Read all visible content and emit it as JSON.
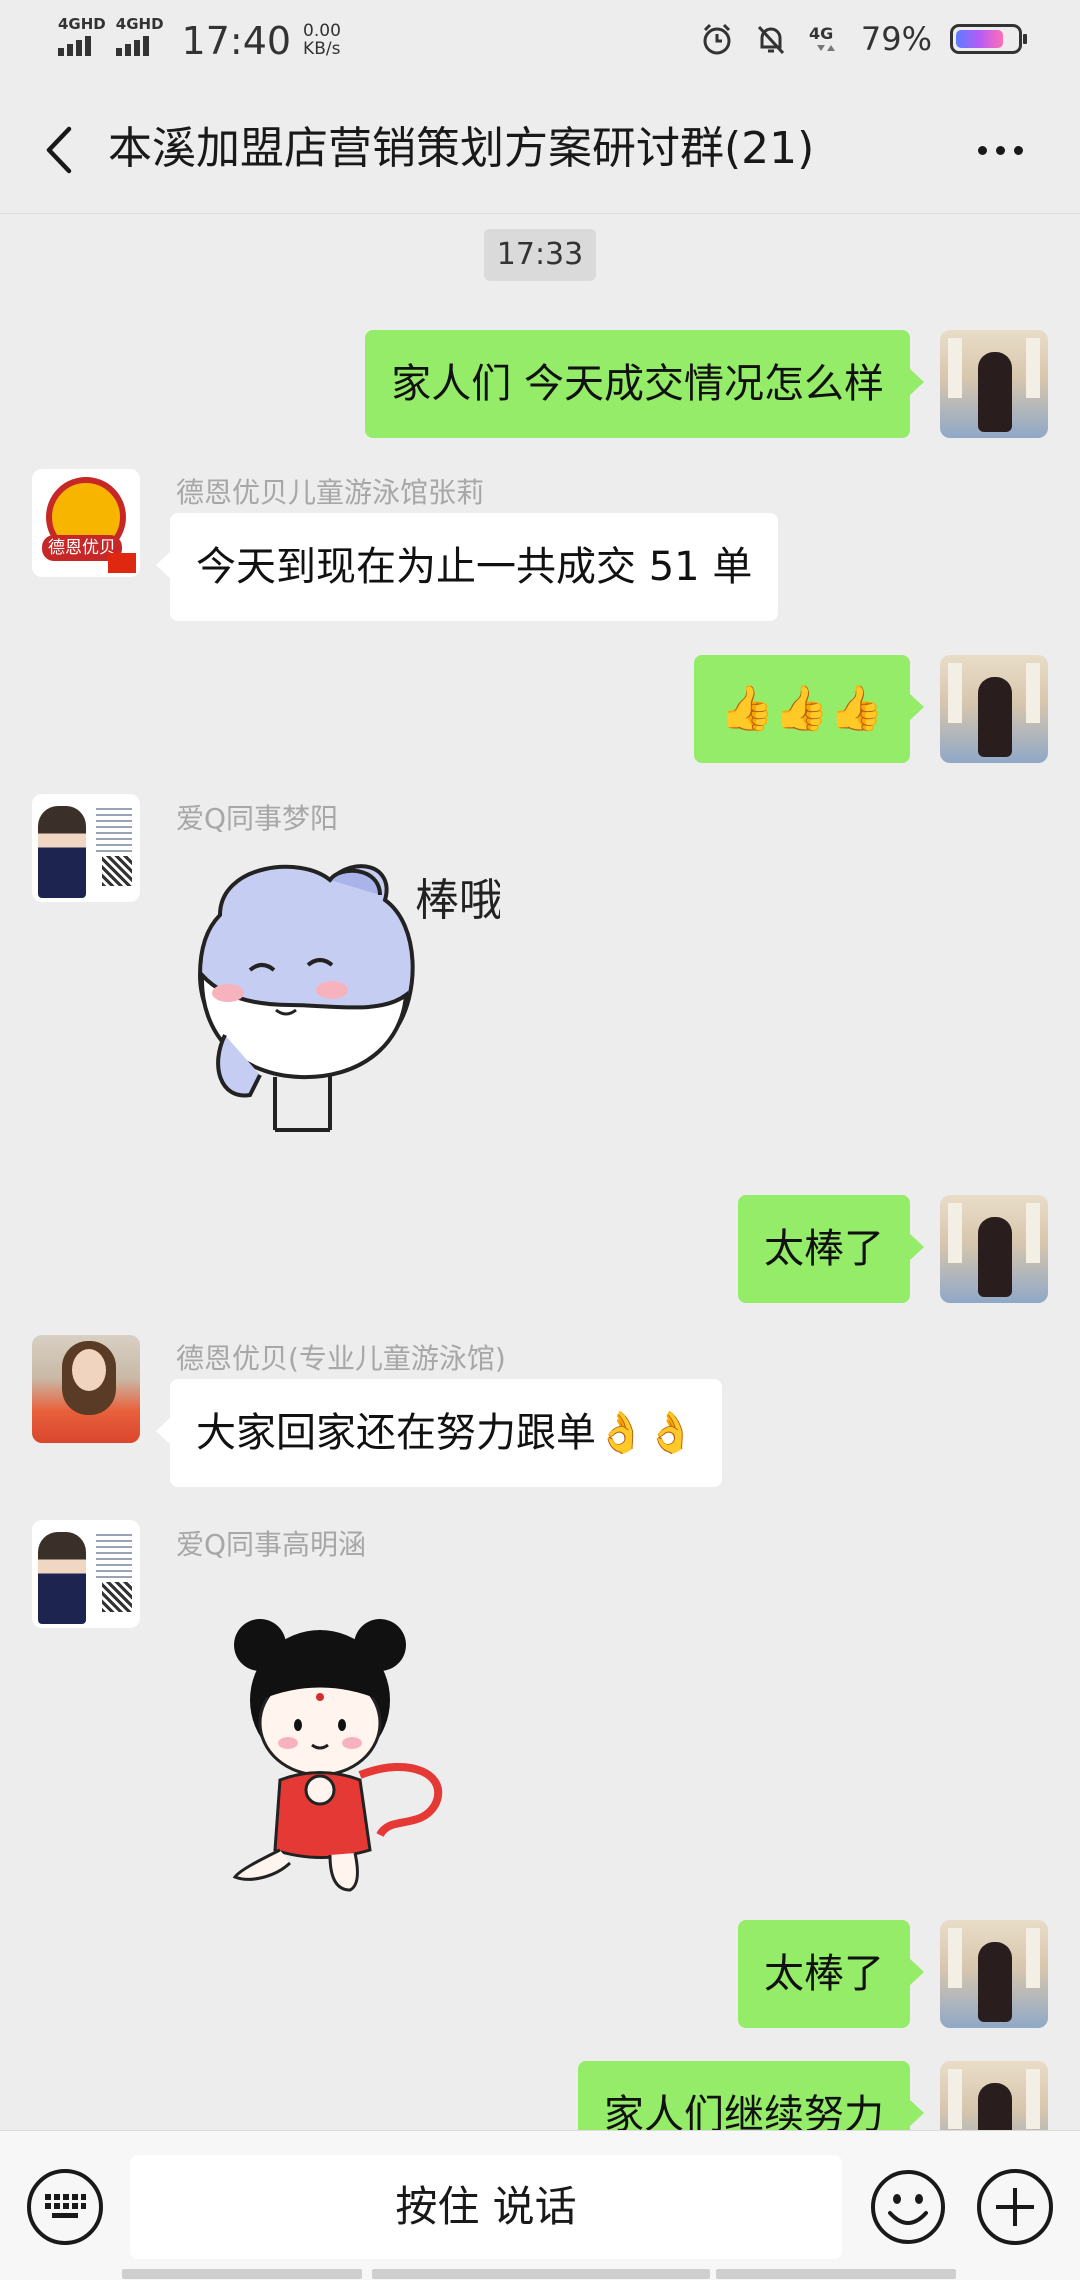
{
  "status_bar": {
    "sim1": "4GHD",
    "sim2": "4GHD",
    "time": "17:40",
    "speed_value": "0.00",
    "speed_unit": "KB/s",
    "network": "4G",
    "battery": "79%",
    "battery_level": 0.79
  },
  "header": {
    "title": "本溪加盟店营销策划方案研讨群(21)"
  },
  "chat": {
    "timestamp": "17:33",
    "messages": [
      {
        "sender": "",
        "direction": "out",
        "text": "家人们 今天成交情况怎么样"
      },
      {
        "sender": "德恩优贝儿童游泳馆张莉",
        "direction": "in",
        "text": "今天到现在为止一共成交 51 单",
        "avatar_text": "德恩优贝"
      },
      {
        "sender": "",
        "direction": "out",
        "text": "👍👍👍"
      },
      {
        "sender": "爱Q同事梦阳",
        "direction": "in",
        "sticker": "棒哦~",
        "sticker_text": "棒哦~"
      },
      {
        "sender": "",
        "direction": "out",
        "text": "太棒了"
      },
      {
        "sender": "德恩优贝(专业儿童游泳馆)",
        "direction": "in",
        "text": "大家回家还在努力跟单👌👌"
      },
      {
        "sender": "爱Q同事高明涵",
        "direction": "in",
        "sticker": "red-dress-girl-sticker"
      },
      {
        "sender": "",
        "direction": "out",
        "text": "太棒了"
      },
      {
        "sender": "",
        "direction": "out",
        "text": "家人们继续努力"
      }
    ]
  },
  "input_bar": {
    "voice_label": "按住 说话",
    "keyboard_icon": "keyboard-icon",
    "emoji_icon": "smile-icon",
    "plus_icon": "plus-icon"
  }
}
